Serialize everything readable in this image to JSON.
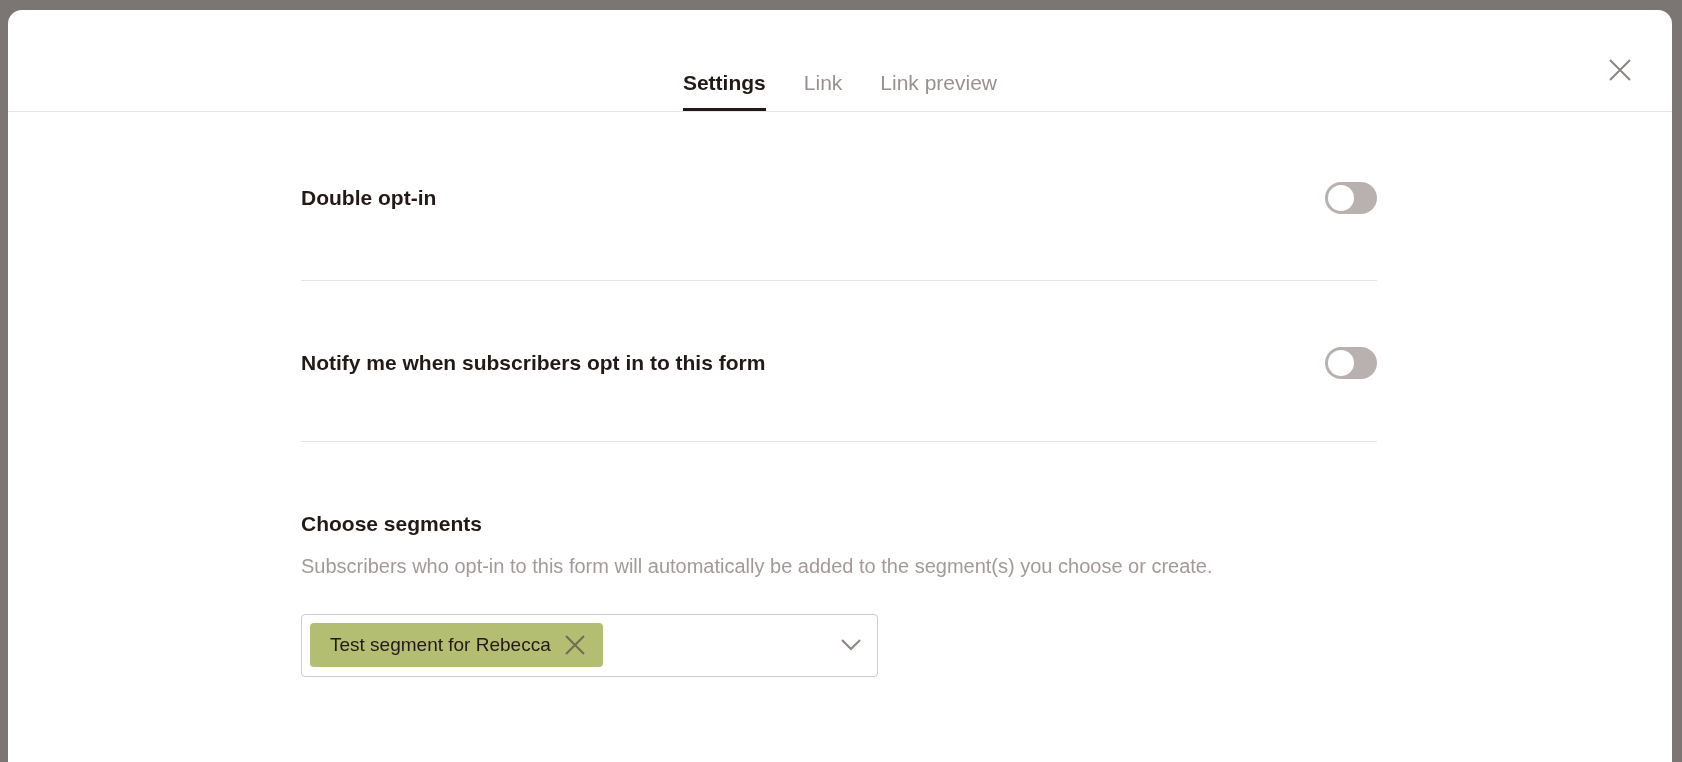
{
  "tabs": [
    {
      "label": "Settings",
      "selected": true
    },
    {
      "label": "Link",
      "selected": false
    },
    {
      "label": "Link preview",
      "selected": false
    }
  ],
  "settings": [
    {
      "label": "Double opt-in",
      "on": false
    },
    {
      "label": "Notify me when subscribers opt in to this form",
      "on": false
    }
  ],
  "segments": {
    "title": "Choose segments",
    "description": "Subscribers who opt-in to this form will automatically be added to the segment(s) you choose or create.",
    "chips": [
      {
        "label": "Test segment for Rebecca"
      }
    ]
  }
}
